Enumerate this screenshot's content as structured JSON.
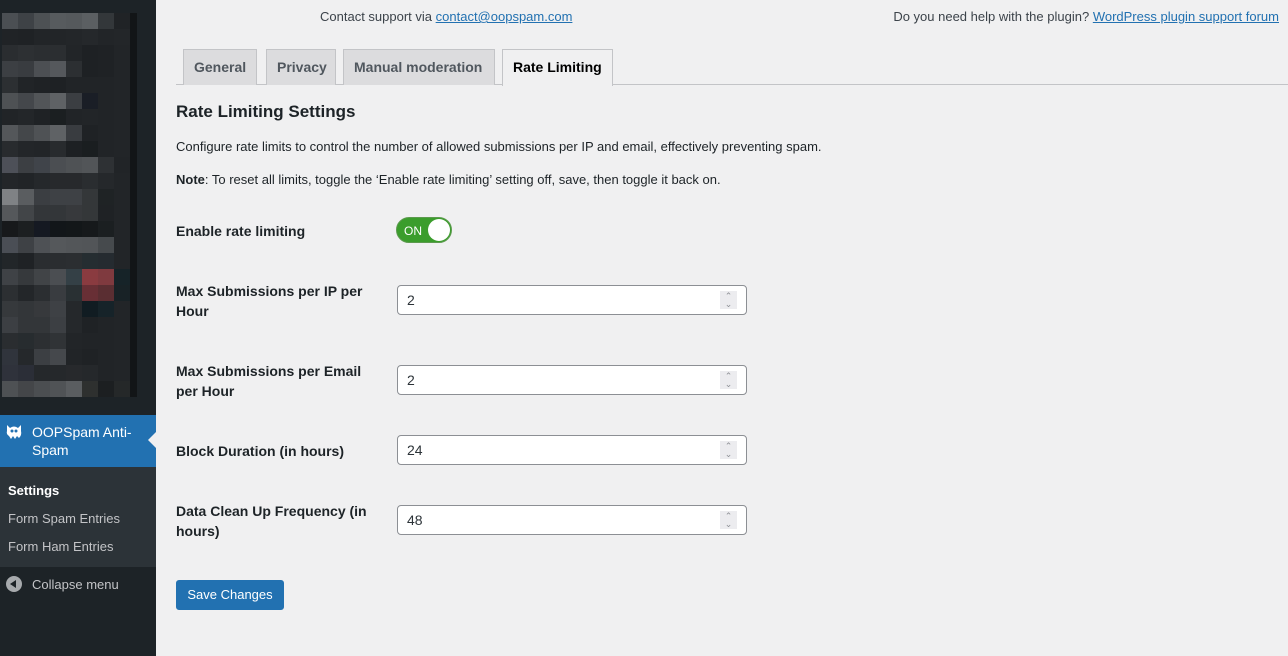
{
  "sidebar": {
    "redacted_mosaic": [
      [
        "#4b4f53",
        "#3e4246",
        "#4d5154",
        "#575b5e",
        "#55595c",
        "#5b5f62",
        "#33373a",
        "#202326",
        "#121517"
      ],
      [
        "#202326",
        "#1f2225",
        "#222528",
        "#222528",
        "#232629",
        "#25282b",
        "#222528",
        "#232629",
        "#121517"
      ],
      [
        "#2a2d30",
        "#2d3033",
        "#2b2e31",
        "#2b2e31",
        "#222528",
        "#1e2124",
        "#1f2225",
        "#222528",
        "#121517"
      ],
      [
        "#3c3f43",
        "#393c40",
        "#4c4f53",
        "#55585c",
        "#2c2f32",
        "#1e2124",
        "#1f2225",
        "#222528",
        "#121517"
      ],
      [
        "#2c2f32",
        "#212427",
        "#1f2225",
        "#1e2124",
        "#212427",
        "#212427",
        "#212427",
        "#222528",
        "#121517"
      ],
      [
        "#4e5154",
        "#44474b",
        "#525558",
        "#5f6265",
        "#3b3e42",
        "#1a1e26",
        "#212427",
        "#222528",
        "#121517"
      ],
      [
        "#212427",
        "#232629",
        "#1f2225",
        "#1b1f21",
        "#212427",
        "#222528",
        "#212427",
        "#222528",
        "#121517"
      ],
      [
        "#54575a",
        "#44474a",
        "#4f5255",
        "#5f6265",
        "#393c40",
        "#1f2225",
        "#212427",
        "#222528",
        "#121517"
      ],
      [
        "#282b2e",
        "#232629",
        "#222528",
        "#282b2e",
        "#1d2023",
        "#1a1e20",
        "#212427",
        "#222528",
        "#121517"
      ],
      [
        "#4d5058",
        "#3c3f43",
        "#40444a",
        "#4b4e52",
        "#4f5255",
        "#525558",
        "#2e3134",
        "#212427",
        "#121517"
      ],
      [
        "#232629",
        "#212427",
        "#25282b",
        "#27292c",
        "#27292c",
        "#2a2d30",
        "#25282b",
        "#222528",
        "#121517"
      ],
      [
        "#7f8285",
        "#5a5d60",
        "#3b3e42",
        "#3e4145",
        "#3e4145",
        "#343739",
        "#1f2325",
        "#222528",
        "#121517"
      ],
      [
        "#55585b",
        "#424548",
        "#333639",
        "#333639",
        "#37393c",
        "#343739",
        "#1f2225",
        "#222528",
        "#121517"
      ],
      [
        "#17191b",
        "#1c1f21",
        "#151922",
        "#121619",
        "#131719",
        "#16191b",
        "#1b1f21",
        "#222528",
        "#121517"
      ],
      [
        "#4a4e55",
        "#3e4145",
        "#4e5155",
        "#55585b",
        "#535659",
        "#525558",
        "#464a4d",
        "#222528",
        "#121517"
      ],
      [
        "#222629",
        "#1f2225",
        "#2a2d30",
        "#2a2d30",
        "#2b2e31",
        "#252d31",
        "#252b30",
        "#222528",
        "#121517"
      ],
      [
        "#3f4246",
        "#36393c",
        "#414447",
        "#4b4e52",
        "#344046",
        "#8a3b40",
        "#7f3a3f",
        "#162328",
        "#121517"
      ],
      [
        "#2c2f32",
        "#232629",
        "#2b2e31",
        "#393c40",
        "#293033",
        "#682f35",
        "#5a2e32",
        "#182226",
        "#121517"
      ],
      [
        "#36393c",
        "#333639",
        "#37393c",
        "#3e4145",
        "#25282b",
        "#111c22",
        "#162329",
        "#222528",
        "#121517"
      ],
      [
        "#3c3f43",
        "#333639",
        "#333639",
        "#3c3f43",
        "#25282b",
        "#1f2225",
        "#212427",
        "#222528",
        "#121517"
      ],
      [
        "#2a2d30",
        "#272c2f",
        "#2c2f32",
        "#303336",
        "#222528",
        "#212427",
        "#212427",
        "#222528",
        "#121517"
      ],
      [
        "#30343c",
        "#25282b",
        "#3c3f43",
        "#45484c",
        "#212427",
        "#1f2225",
        "#212427",
        "#222528",
        "#121517"
      ],
      [
        "#2f323b",
        "#2b2e37",
        "#25282b",
        "#25282b",
        "#27292c",
        "#25282b",
        "#212427",
        "#222528",
        "#121517"
      ],
      [
        "#4e5154",
        "#444649",
        "#4b4e51",
        "#505356",
        "#5a5d60",
        "#2e302f",
        "#1c1f21",
        "#252829",
        "#121517"
      ]
    ],
    "active_menu": {
      "label": "OOPSpam Anti-Spam",
      "icon": "ghost-icon"
    },
    "submenu": [
      {
        "label": "Settings",
        "current": true
      },
      {
        "label": "Form Spam Entries",
        "current": false
      },
      {
        "label": "Form Ham Entries",
        "current": false
      }
    ],
    "collapse_label": "Collapse menu"
  },
  "header": {
    "contact_prefix": "Contact support via",
    "contact_link": "contact@oopspam.com",
    "help_prefix": "Do you need help with the plugin?",
    "help_link": "WordPress plugin support forum"
  },
  "tabs": [
    {
      "label": "General",
      "active": false
    },
    {
      "label": "Privacy",
      "active": false
    },
    {
      "label": "Manual moderation",
      "active": false
    },
    {
      "label": "Rate Limiting",
      "active": true
    }
  ],
  "section": {
    "title": "Rate Limiting Settings",
    "description": "Configure rate limits to control the number of allowed submissions per IP and email, effectively preventing spam.",
    "note_label": "Note",
    "note_text": ": To reset all limits, toggle the ‘Enable rate limiting’ setting off, save, then toggle it back on."
  },
  "fields": {
    "enable": {
      "label": "Enable rate limiting",
      "toggle_text": "ON",
      "value": true
    },
    "max_ip": {
      "label": "Max Submissions per IP per Hour",
      "value": "2"
    },
    "max_email": {
      "label": "Max Submissions per Email per Hour",
      "value": "2"
    },
    "block_duration": {
      "label": "Block Duration (in hours)",
      "value": "24"
    },
    "cleanup": {
      "label": "Data Clean Up Frequency (in hours)",
      "value": "48"
    }
  },
  "save_label": "Save Changes",
  "colors": {
    "accent": "#2271b1",
    "toggle_on": "#3b9d2c",
    "sidebar": "#1d2327"
  }
}
